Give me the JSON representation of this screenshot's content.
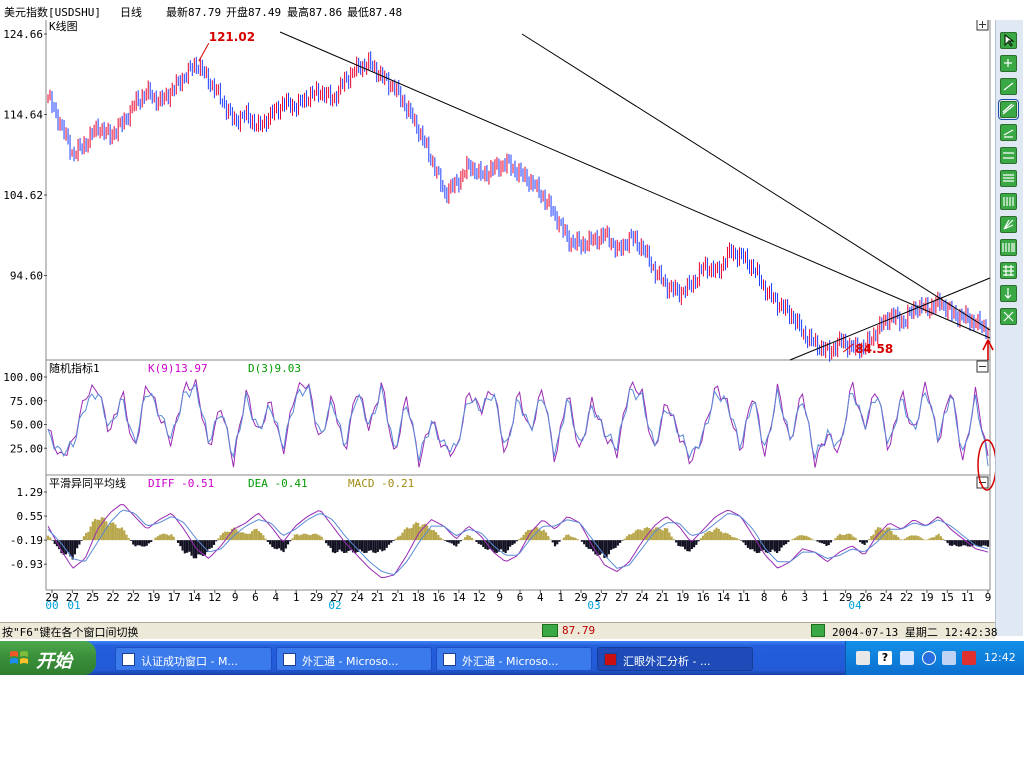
{
  "header": {
    "symbol": "美元指数[USDSHU]",
    "period": "日线",
    "latest": "最新87.79",
    "open": "开盘87.49",
    "high": "最高87.86",
    "low": "最低87.48"
  },
  "colors": {
    "candle_up": "#e8002a",
    "candle_down": "#1a3cff",
    "k_line": "#9a2cb4",
    "d_line": "#5a8ad6",
    "macd_pos": "#b7a64a",
    "macd_neg": "#111122",
    "accent_red": "#d60000"
  },
  "chart_data": [
    {
      "type": "candlestick",
      "panel_label": "K线图",
      "y_ticks": [
        "124.66",
        "114.64",
        "104.62",
        "94.60"
      ],
      "ylim": [
        84.58,
        124.66
      ],
      "annotations": [
        {
          "text": "121.02",
          "y": 121.02
        },
        {
          "text": "84.58",
          "y": 84.58
        }
      ],
      "series": [
        {
          "values": [
            116.8,
            113.5,
            109.6,
            111.0,
            113.1,
            112.0,
            113.5,
            116.0,
            117.4,
            116.2,
            117.6,
            119.4,
            121.02,
            118.8,
            116.5,
            113.8,
            114.6,
            113.0,
            114.6,
            116.1,
            115.6,
            116.9,
            117.5,
            116.5,
            119.0,
            120.5,
            121.0,
            119.2,
            117.9,
            115.3,
            112.4,
            108.8,
            104.8,
            106.2,
            108.3,
            107.0,
            108.0,
            108.6,
            107.4,
            106.2,
            104.3,
            101.8,
            99.0,
            98.4,
            99.0,
            99.7,
            97.6,
            99.4,
            98.0,
            95.0,
            93.2,
            92.4,
            93.6,
            95.8,
            95.0,
            97.5,
            97.0,
            95.3,
            92.5,
            91.0,
            89.7,
            87.2,
            86.0,
            85.0,
            86.5,
            85.5,
            85.8,
            88.0,
            89.7,
            88.8,
            90.7,
            90.5,
            91.3,
            89.8,
            89.4,
            88.6,
            87.8
          ]
        }
      ]
    },
    {
      "type": "line",
      "panel_label": "随机指标1",
      "y_ticks": [
        "100.00",
        "75.00",
        "50.00",
        "25.00"
      ],
      "ylim": [
        0,
        100
      ],
      "series": [
        {
          "name": "K(9)13.97",
          "values": [
            45,
            15,
            30,
            80,
            90,
            40,
            85,
            20,
            95,
            60,
            30,
            88,
            92,
            25,
            70,
            10,
            85,
            40,
            75,
            20,
            85,
            95,
            30,
            80,
            20,
            90,
            45,
            95,
            15,
            80,
            10,
            55,
            25,
            20,
            85,
            65,
            90,
            15,
            85,
            40,
            90,
            10,
            85,
            20,
            75,
            40,
            20,
            90,
            85,
            20,
            75,
            40,
            10,
            40,
            90,
            70,
            20,
            85,
            15,
            90,
            30,
            85,
            10,
            40,
            20,
            95,
            45,
            90,
            20,
            85,
            40,
            95,
            30,
            90,
            10,
            85,
            14
          ]
        },
        {
          "name": "D(3)9.03",
          "values": [
            40,
            20,
            28,
            70,
            85,
            45,
            78,
            28,
            88,
            62,
            35,
            82,
            88,
            32,
            65,
            16,
            78,
            44,
            70,
            26,
            78,
            90,
            36,
            75,
            26,
            84,
            48,
            88,
            22,
            74,
            16,
            52,
            28,
            24,
            78,
            66,
            84,
            22,
            78,
            44,
            84,
            16,
            78,
            26,
            70,
            42,
            26,
            84,
            80,
            26,
            70,
            42,
            16,
            40,
            84,
            70,
            26,
            78,
            22,
            84,
            34,
            78,
            16,
            40,
            26,
            88,
            48,
            84,
            26,
            78,
            42,
            88,
            34,
            84,
            16,
            78,
            9
          ]
        }
      ]
    },
    {
      "type": "line",
      "panel_label": "平滑异同平均线",
      "y_ticks": [
        "1.29",
        "0.55",
        "-0.19",
        "-0.93"
      ],
      "ylim": [
        -1.6,
        1.29
      ],
      "x_tick_labels": [
        "29",
        "27",
        "25",
        "22",
        "22",
        "19",
        "17",
        "14",
        "12",
        "9",
        "6",
        "4",
        "1",
        "29",
        "27",
        "24",
        "21",
        "21",
        "18",
        "16",
        "14",
        "12",
        "9",
        "6",
        "4",
        "1",
        "29",
        "27",
        "27",
        "24",
        "21",
        "19",
        "16",
        "14",
        "11",
        "8",
        "6",
        "3",
        "1",
        "29",
        "26",
        "24",
        "22",
        "19",
        "15",
        "11",
        "9"
      ],
      "year_labels": [
        "00",
        "01",
        "02",
        "03",
        "04"
      ],
      "series": [
        {
          "name": "DIFF -0.51",
          "values": [
            0.3,
            -0.4,
            -1.0,
            -0.7,
            0.2,
            0.7,
            1.0,
            0.6,
            0.2,
            0.5,
            0.7,
            0.2,
            -0.4,
            -0.7,
            -0.3,
            0.2,
            0.4,
            0.7,
            0.3,
            -0.2,
            0.3,
            0.6,
            0.8,
            0.3,
            -0.2,
            -0.6,
            -1.0,
            -1.3,
            -1.2,
            -0.6,
            0.1,
            0.5,
            0.3,
            -0.1,
            0.3,
            0.0,
            -0.5,
            -0.8,
            -0.6,
            0.1,
            0.5,
            0.2,
            0.6,
            0.4,
            -0.3,
            -0.9,
            -1.1,
            -0.8,
            -0.2,
            0.3,
            0.6,
            0.3,
            -0.2,
            0.2,
            0.6,
            0.8,
            0.6,
            0.0,
            -0.6,
            -1.0,
            -0.8,
            -0.4,
            -0.5,
            -0.8,
            -0.5,
            -0.3,
            -0.6,
            0.0,
            0.4,
            0.2,
            0.5,
            0.3,
            0.6,
            0.2,
            -0.1,
            -0.4,
            -0.5
          ]
        },
        {
          "name": "DEA -0.41",
          "values": [
            0.2,
            -0.2,
            -0.7,
            -0.8,
            -0.2,
            0.4,
            0.8,
            0.7,
            0.3,
            0.4,
            0.6,
            0.4,
            -0.1,
            -0.5,
            -0.4,
            0.0,
            0.3,
            0.5,
            0.4,
            0.0,
            0.2,
            0.5,
            0.7,
            0.5,
            0.0,
            -0.4,
            -0.8,
            -1.1,
            -1.2,
            -0.8,
            -0.2,
            0.3,
            0.3,
            0.0,
            0.2,
            0.1,
            -0.3,
            -0.6,
            -0.6,
            -0.1,
            0.3,
            0.3,
            0.5,
            0.4,
            -0.1,
            -0.6,
            -1.0,
            -0.9,
            -0.4,
            0.1,
            0.4,
            0.4,
            0.0,
            0.1,
            0.4,
            0.7,
            0.6,
            0.2,
            -0.4,
            -0.8,
            -0.8,
            -0.5,
            -0.5,
            -0.7,
            -0.6,
            -0.4,
            -0.5,
            -0.2,
            0.2,
            0.2,
            0.4,
            0.3,
            0.5,
            0.3,
            0.0,
            -0.3,
            -0.4
          ]
        },
        {
          "name": "MACD -0.21",
          "values": [
            0.2,
            -0.4,
            -0.6,
            0.2,
            0.8,
            0.6,
            0.4,
            -0.2,
            -0.2,
            0.2,
            0.2,
            -0.4,
            -0.6,
            -0.4,
            0.2,
            0.4,
            0.2,
            0.4,
            -0.2,
            -0.4,
            0.2,
            0.2,
            0.2,
            -0.4,
            -0.4,
            -0.4,
            -0.4,
            -0.4,
            0.0,
            0.4,
            0.6,
            0.4,
            0.0,
            -0.2,
            0.2,
            -0.2,
            -0.4,
            -0.4,
            0.0,
            0.4,
            0.4,
            -0.2,
            0.2,
            0.0,
            -0.4,
            -0.6,
            -0.2,
            0.2,
            0.4,
            0.4,
            0.4,
            -0.2,
            -0.4,
            0.2,
            0.4,
            0.2,
            0.0,
            -0.4,
            -0.4,
            -0.4,
            0.0,
            0.2,
            0.0,
            -0.2,
            0.2,
            0.2,
            -0.2,
            0.4,
            0.4,
            0.0,
            0.2,
            0.0,
            0.2,
            -0.2,
            -0.2,
            -0.2,
            -0.21
          ]
        }
      ]
    }
  ],
  "statusbar": {
    "hint": "按\"F6\"键在各个窗口间切换",
    "price": "87.79",
    "datetime": "2004-07-13 星期二 12:42:38"
  },
  "taskbar": {
    "start_label": "开始",
    "tasks": [
      {
        "label": "认证成功窗口 - M..."
      },
      {
        "label": "外汇通 - Microso..."
      },
      {
        "label": "外汇通 - Microso..."
      },
      {
        "label": "汇眼外汇分析 - ..."
      }
    ],
    "clock": "12:42",
    "tray_icons": [
      "keyboard-icon",
      "help-icon",
      "network-icon",
      "back-icon",
      "volume-icon",
      "antivirus-icon"
    ]
  },
  "toolbar": {
    "tools": [
      "cursor-icon",
      "zoom-in-icon",
      "line-tool-icon",
      "trendline-tool-icon",
      "ray-tool-icon",
      "channel-tool-icon",
      "parallel-tool-icon",
      "fibonacci-tool-icon",
      "gann-tool-icon",
      "cycle-tool-icon",
      "grid-tool-icon",
      "arrow-tool-icon",
      "delete-tool-icon"
    ]
  }
}
